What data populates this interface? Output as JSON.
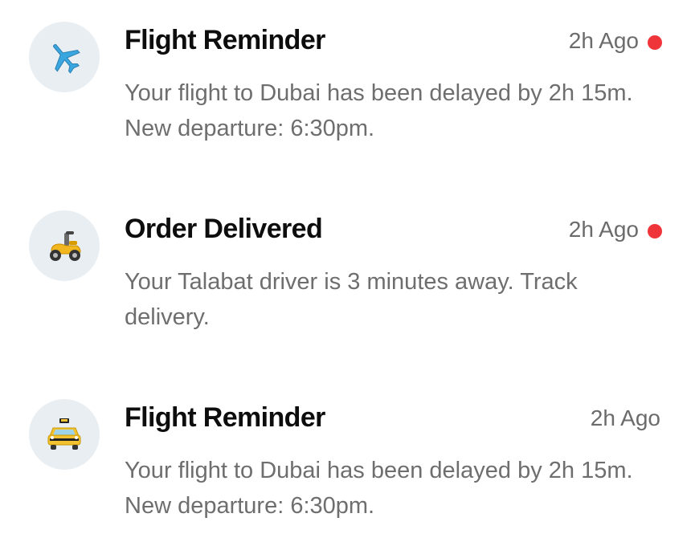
{
  "notifications": [
    {
      "icon": "airplane-icon",
      "title": "Flight Reminder",
      "time": "2h Ago",
      "unread": true,
      "message": "Your flight to Dubai has been delayed by 2h 15m. New departure: 6:30pm."
    },
    {
      "icon": "scooter-icon",
      "title": "Order Delivered",
      "time": "2h Ago",
      "unread": true,
      "message": "Your Talabat driver is 3 minutes away. Track delivery."
    },
    {
      "icon": "taxi-icon",
      "title": "Flight Reminder",
      "time": "2h Ago",
      "unread": false,
      "message": "Your flight to Dubai has been delayed by 2h 15m. New departure: 6:30pm."
    }
  ],
  "colors": {
    "unread_dot": "#f0353a",
    "avatar_bg": "#e8eef2",
    "title": "#0d0d0d",
    "muted": "#6e6e6e"
  }
}
